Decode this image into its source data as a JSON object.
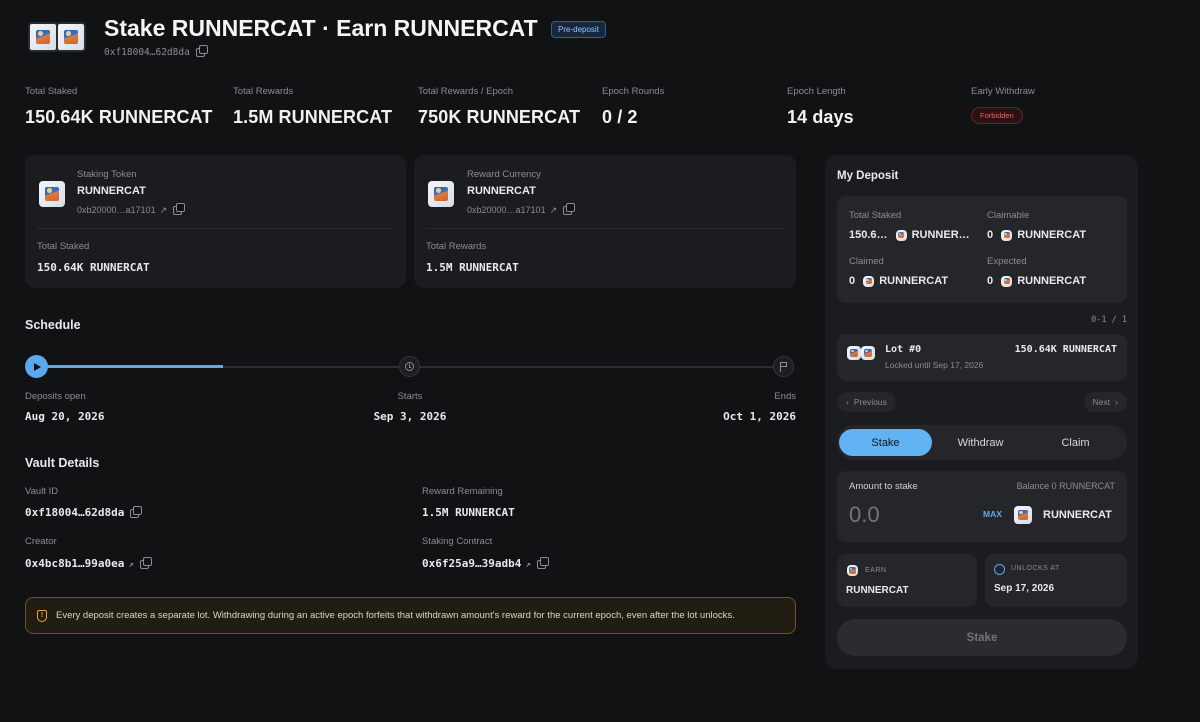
{
  "header": {
    "title": "Stake RUNNERCAT · Earn RUNNERCAT",
    "badge": "Pre-deposit",
    "address": "0xf18004…62d8da"
  },
  "stats": [
    {
      "label": "Total Staked",
      "value": "150.64K RUNNERCAT"
    },
    {
      "label": "Total Rewards",
      "value": "1.5M RUNNERCAT"
    },
    {
      "label": "Total Rewards / Epoch",
      "value": "750K RUNNERCAT"
    },
    {
      "label": "Epoch Rounds",
      "value": "0 / 2"
    },
    {
      "label": "Epoch Length",
      "value": "14 days"
    },
    {
      "label": "Early Withdraw",
      "value": "Forbidden"
    }
  ],
  "staking_token": {
    "label": "Staking Token",
    "name": "RUNNERCAT",
    "address": "0xb20000…a17101",
    "total_label": "Total Staked",
    "total_value": "150.64K RUNNERCAT"
  },
  "reward_currency": {
    "label": "Reward Currency",
    "name": "RUNNERCAT",
    "address": "0xb20000…a17101",
    "total_label": "Total Rewards",
    "total_value": "1.5M RUNNERCAT"
  },
  "schedule": {
    "title": "Schedule",
    "progress": 0.25,
    "points": [
      {
        "label": "Deposits open",
        "date": "Aug 20, 2026"
      },
      {
        "label": "Starts",
        "date": "Sep 3, 2026"
      },
      {
        "label": "Ends",
        "date": "Oct 1, 2026"
      }
    ]
  },
  "vault": {
    "title": "Vault Details",
    "vault_id_label": "Vault ID",
    "vault_id": "0xf18004…62d8da",
    "reward_remaining_label": "Reward Remaining",
    "reward_remaining": "1.5M RUNNERCAT",
    "creator_label": "Creator",
    "creator": "0x4bc8b1…99a0ea",
    "contract_label": "Staking Contract",
    "contract": "0x6f25a9…39adb4"
  },
  "notice": "Every deposit creates a separate lot. Withdrawing during an active epoch forfeits that withdrawn amount's reward for the current epoch, even after the lot unlocks.",
  "deposit": {
    "title": "My Deposit",
    "total_staked_label": "Total Staked",
    "total_staked_num": "150.6…",
    "total_staked_token": "RUNNER…",
    "claimable_label": "Claimable",
    "claimable_num": "0",
    "claimable_token": "RUNNERCAT",
    "claimed_label": "Claimed",
    "claimed_num": "0",
    "claimed_token": "RUNNERCAT",
    "expected_label": "Expected",
    "expected_num": "0",
    "expected_token": "RUNNERCAT",
    "pager": "0-1 / 1",
    "lot_title": "Lot #0",
    "lot_amount": "150.64K RUNNERCAT",
    "lot_sub": "Locked until Sep 17, 2026",
    "prev": "Previous",
    "next": "Next",
    "tabs": [
      "Stake",
      "Withdraw",
      "Claim"
    ],
    "amount_label": "Amount to stake",
    "balance_label": "Balance",
    "balance_value": "0 RUNNERCAT",
    "amount_placeholder": "0.0",
    "max": "MAX",
    "token": "RUNNERCAT",
    "earn_label": "EARN",
    "earn_value": "RUNNERCAT",
    "unlocks_label": "UNLOCKS AT",
    "unlocks_value": "Sep 17, 2026",
    "submit": "Stake"
  },
  "colors": {
    "accent": "#5aa9ee",
    "danger": "#ff5b5b",
    "warn_border": "#6a5526",
    "warn_bg": "#221d13"
  }
}
